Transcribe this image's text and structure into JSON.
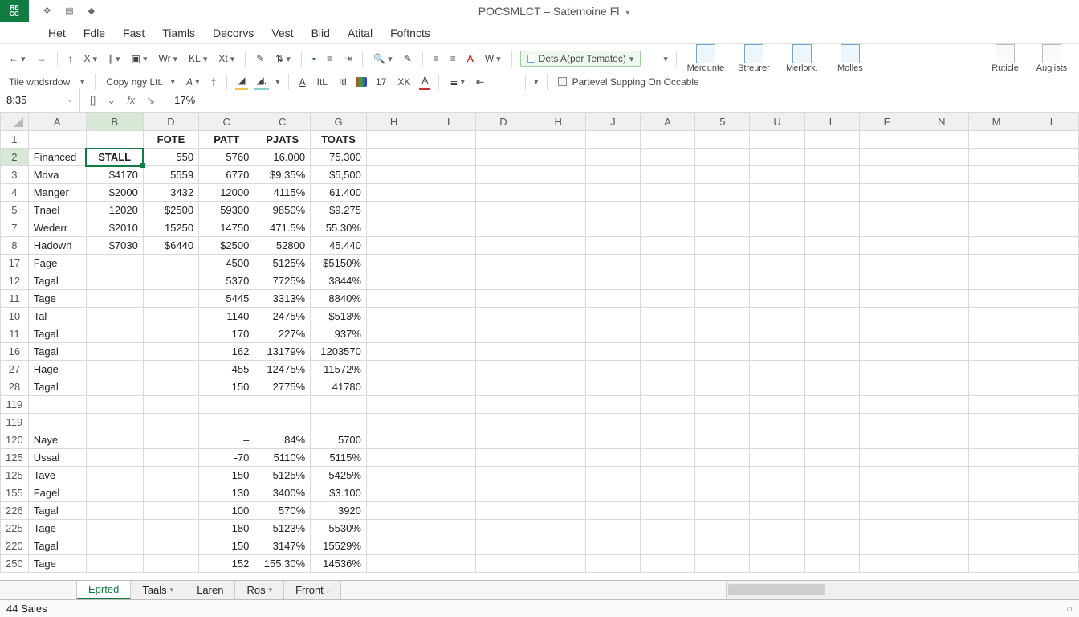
{
  "app_badge": {
    "line1": "RE",
    "line2": "CG"
  },
  "title": "POCSMLCT – Satemoine Fl",
  "menu": [
    "Het",
    "Fdle",
    "Fast",
    "Tiamls",
    "Decorvs",
    "Vest",
    "Biid",
    "Atital",
    "Foftncts"
  ],
  "ribbon": {
    "row1": {
      "tile": "Tile wndsrdow",
      "copy": "Copy ngy Ltt.",
      "wr": "Wr",
      "kl": "KL",
      "xt": "Xt",
      "dets": "Dets A(per Tematec)",
      "big": [
        "Merdunte",
        "Streurer",
        "Merlork.",
        "Molles"
      ],
      "far": [
        "Ruticle",
        "Auglists"
      ]
    },
    "row2": {
      "n17": "17",
      "xk": "XK",
      "itl": "ItL",
      "itl2": "ItI",
      "partevel": "Partevel Supping On Occable"
    }
  },
  "namebox": "8:35",
  "formula_value": "17%",
  "columns": [
    "A",
    "B",
    "D",
    "C",
    "C",
    "G",
    "H",
    "I",
    "D",
    "H",
    "J",
    "A",
    "5",
    "U",
    "L",
    "F",
    "N",
    "M",
    "I"
  ],
  "col_headers": {
    "D": "FOTE",
    "C1": "PATT",
    "C2": "PJATS",
    "G": "TOATS"
  },
  "rows": [
    {
      "n": "1",
      "A": "",
      "B": "",
      "D": "FOTE",
      "C1": "PATT",
      "C2": "PJATS",
      "G": "TOATS",
      "hdr": true
    },
    {
      "n": "2",
      "A": "Financed",
      "B": "STALL",
      "D": "550",
      "C1": "5760",
      "C2": "16.000",
      "G": "75.300",
      "sel": true
    },
    {
      "n": "3",
      "A": "Mdva",
      "B": "$4170",
      "D": "5559",
      "C1": "6770",
      "C2": "$9.35%",
      "G": "$5,500"
    },
    {
      "n": "4",
      "A": "Manger",
      "B": "$2000",
      "D": "3432",
      "C1": "12000",
      "C2": "4115%",
      "G": "61.400"
    },
    {
      "n": "5",
      "A": "Tnael",
      "B": "12020",
      "D": "$2500",
      "C1": "59300",
      "C2": "9850%",
      "G": "$9.275"
    },
    {
      "n": "7",
      "A": "Wederr",
      "B": "$2010",
      "D": "15250",
      "C1": "14750",
      "C2": "471.5%",
      "G": "55.30%"
    },
    {
      "n": "8",
      "A": "Hadown",
      "B": "$7030",
      "D": "$6440",
      "C1": "$2500",
      "C2": "52800",
      "G": "45.440"
    },
    {
      "n": "17",
      "A": "Fage",
      "B": "",
      "D": "",
      "C1": "4500",
      "C2": "5125%",
      "G": "$5150%"
    },
    {
      "n": "12",
      "A": "Tagal",
      "B": "",
      "D": "",
      "C1": "5370",
      "C2": "7725%",
      "G": "3844%"
    },
    {
      "n": "11",
      "A": "Tage",
      "B": "",
      "D": "",
      "C1": "5445",
      "C2": "3313%",
      "G": "8840%"
    },
    {
      "n": "10",
      "A": "Tal",
      "B": "",
      "D": "",
      "C1": "1140",
      "C2": "2475%",
      "G": "$513%"
    },
    {
      "n": "11",
      "A": "Tagal",
      "B": "",
      "D": "",
      "C1": "170",
      "C2": "227%",
      "G": "937%"
    },
    {
      "n": "16",
      "A": "Tagal",
      "B": "",
      "D": "",
      "C1": "162",
      "C2": "13179%",
      "G": "1203570"
    },
    {
      "n": "27",
      "A": "Hage",
      "B": "",
      "D": "",
      "C1": "455",
      "C2": "12475%",
      "G": "11572%"
    },
    {
      "n": "28",
      "A": "Tagal",
      "B": "",
      "D": "",
      "C1": "150",
      "C2": "2775%",
      "G": "41780"
    },
    {
      "n": "119",
      "A": "",
      "B": "",
      "D": "",
      "C1": "",
      "C2": "",
      "G": ""
    },
    {
      "n": "119",
      "A": "",
      "B": "",
      "D": "",
      "C1": "",
      "C2": "",
      "G": ""
    },
    {
      "n": "120",
      "A": "Naye",
      "B": "",
      "D": "",
      "C1": "–",
      "C2": "84%",
      "G": "5700"
    },
    {
      "n": "125",
      "A": "Ussal",
      "B": "",
      "D": "",
      "C1": "-70",
      "C2": "5110%",
      "G": "5115%"
    },
    {
      "n": "125",
      "A": "Tave",
      "B": "",
      "D": "",
      "C1": "150",
      "C2": "5125%",
      "G": "5425%"
    },
    {
      "n": "155",
      "A": "Fagel",
      "B": "",
      "D": "",
      "C1": "130",
      "C2": "3400%",
      "G": "$3.100"
    },
    {
      "n": "226",
      "A": "Tagal",
      "B": "",
      "D": "",
      "C1": "100",
      "C2": "570%",
      "G": "3920"
    },
    {
      "n": "225",
      "A": "Tage",
      "B": "",
      "D": "",
      "C1": "180",
      "C2": "5123%",
      "G": "5530%"
    },
    {
      "n": "220",
      "A": "Tagal",
      "B": "",
      "D": "",
      "C1": "150",
      "C2": "3147%",
      "G": "15529%"
    },
    {
      "n": "250",
      "A": "Tage",
      "B": "",
      "D": "",
      "C1": "152",
      "C2": "155.30%",
      "G": "14536%"
    }
  ],
  "sheet_tabs": [
    {
      "label": "Eprted",
      "active": true
    },
    {
      "label": "Taals",
      "drop": true
    },
    {
      "label": "Laren"
    },
    {
      "label": "Ros",
      "drop": true
    },
    {
      "label": "Frront",
      "next": true
    }
  ],
  "status": "44 Sales"
}
